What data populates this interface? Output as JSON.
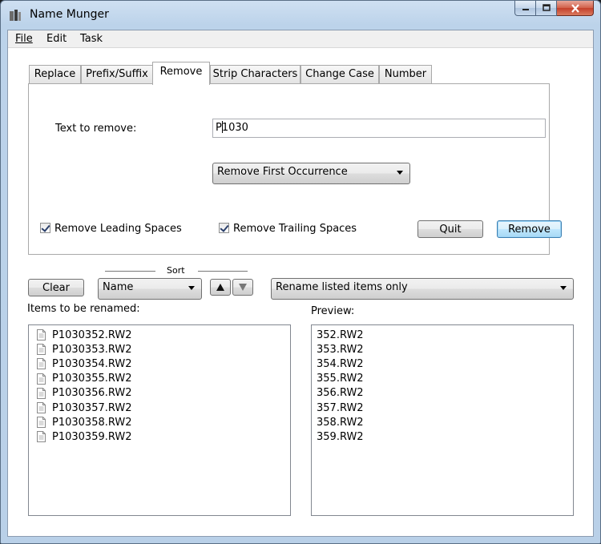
{
  "window": {
    "title": "Name Munger",
    "icons": {
      "app": "app-icon",
      "minimize": "minimize-icon",
      "maximize": "maximize-icon",
      "close": "close-icon"
    }
  },
  "menu": {
    "file": "File",
    "edit": "Edit",
    "task": "Task"
  },
  "tabs": [
    "Replace",
    "Prefix/Suffix",
    "Remove",
    "Strip Characters",
    "Change Case",
    "Number"
  ],
  "remove": {
    "text_label": "Text to remove:",
    "text_value_pre": "P",
    "text_value_post": "1030",
    "mode": "Remove First Occurrence",
    "leading_label": "Remove Leading Spaces",
    "leading_checked": true,
    "trailing_label": "Remove Trailing Spaces",
    "trailing_checked": true,
    "quit_label": "Quit",
    "remove_label": "Remove"
  },
  "sort": {
    "title": "Sort",
    "clear_label": "Clear",
    "field": "Name",
    "scope": "Rename listed items only"
  },
  "items": {
    "header": "Items to be renamed:",
    "files": [
      "P1030352.RW2",
      "P1030353.RW2",
      "P1030354.RW2",
      "P1030355.RW2",
      "P1030356.RW2",
      "P1030357.RW2",
      "P1030358.RW2",
      "P1030359.RW2"
    ]
  },
  "preview": {
    "header": "Preview:",
    "files": [
      "352.RW2",
      "353.RW2",
      "354.RW2",
      "355.RW2",
      "356.RW2",
      "357.RW2",
      "358.RW2",
      "359.RW2"
    ]
  },
  "colors": {
    "accent": "#3c7fb1",
    "title_bar": "#bcd3ea",
    "close": "#c4402a"
  }
}
